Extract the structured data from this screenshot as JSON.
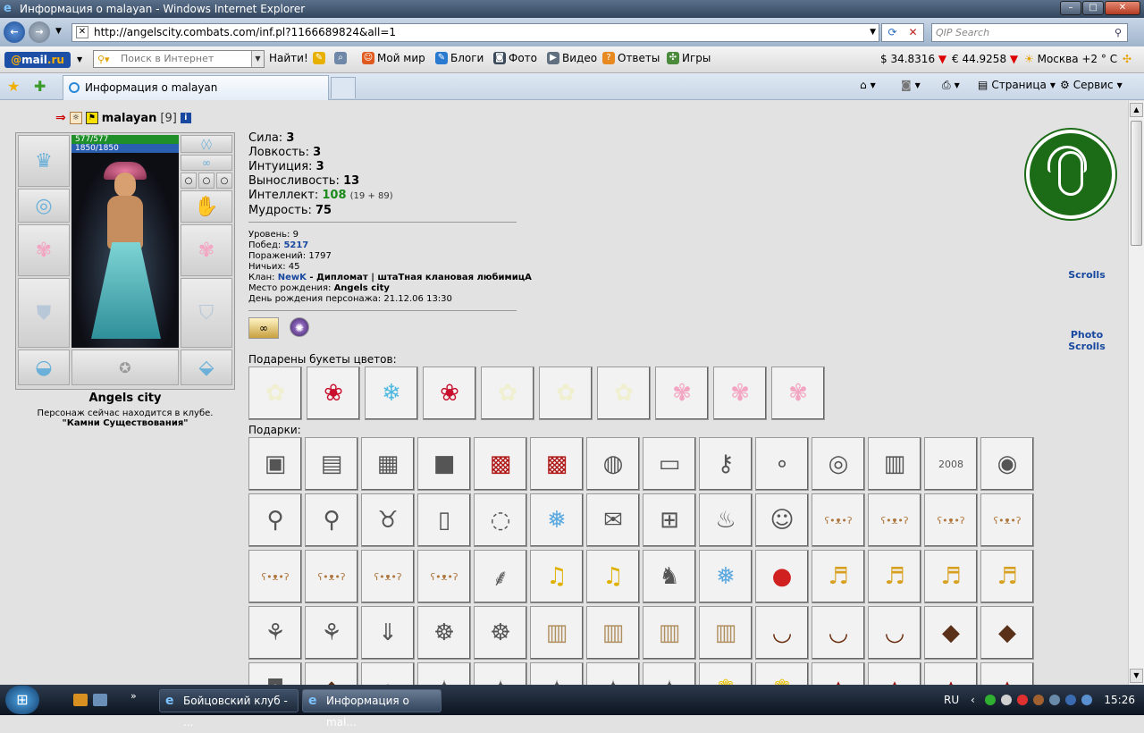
{
  "window": {
    "title": "Информация о malayan - Windows Internet Explorer"
  },
  "address": {
    "url": "http://angelscity.combats.com/inf.pl?1166689824&all=1",
    "search_placeholder": "QIP Search"
  },
  "mailbar": {
    "logo_prefix": "@",
    "logo_mail": "mail",
    "logo_suffix": ".ru",
    "search_placeholder": "Поиск в Интернет",
    "find_label": "Найти!",
    "links": [
      "Мой мир",
      "Блоги",
      "Фото",
      "Видео",
      "Ответы",
      "Игры"
    ],
    "usd": "$ 34.8316",
    "eur": "€ 44.9258",
    "weather": "Москва +2 ° C"
  },
  "tabs": {
    "active": "Информация о malayan",
    "page_menu": "Страница",
    "service_menu": "Сервис"
  },
  "character": {
    "name": "malayan",
    "level_tag": "[9]",
    "hp": "577/577",
    "mana": "1850/1850",
    "city": "Angels city",
    "location_text": "Персонаж сейчас находится в клубе.",
    "club_name": "\"Камни Существования\""
  },
  "stats": [
    {
      "label": "Сила:",
      "value": "3"
    },
    {
      "label": "Ловкость:",
      "value": "3"
    },
    {
      "label": "Интуиция:",
      "value": "3"
    },
    {
      "label": "Выносливость:",
      "value": "13"
    },
    {
      "label": "Интеллект:",
      "value": "108",
      "extra": "(19 + 89)"
    },
    {
      "label": "Мудрость:",
      "value": "75"
    }
  ],
  "info": {
    "level_label": "Уровень:",
    "level": "9",
    "wins_label": "Побед:",
    "wins": "5217",
    "losses_label": "Поражений:",
    "losses": "1797",
    "draws_label": "Ничьих:",
    "draws": "45",
    "clan_label": "Клан:",
    "clan": "NewK",
    "clan_role": " - Дипломат | штаТная клановая любимицА",
    "birthplace_label": "Место рождения:",
    "birthplace": "Angels city",
    "birthday_label": "День рождения персонажа:",
    "birthday": "21.12.06 13:30"
  },
  "sections": {
    "flowers": "Подарены букеты цветов:",
    "gifts": "Подарки:"
  },
  "flowers": [
    "daisy",
    "rose",
    "ice-flower",
    "rose",
    "daisy",
    "daisy",
    "daisy",
    "sakura",
    "sakura",
    "sakura"
  ],
  "gifts": [
    "silver-box",
    "chest",
    "silver-chest",
    "dark-chest",
    "gift-box",
    "gift-box",
    "handbag",
    "blue-box",
    "key",
    "pearls",
    "boa",
    "accordion",
    "2008",
    "gift-bag",
    "mirror",
    "mirror",
    "cow",
    "milk-can",
    "tambourine",
    "snowflake",
    "card",
    "window",
    "samovar",
    "doll",
    "teddy-bear",
    "teddy-bear",
    "teddy-bear",
    "teddy-bear",
    "teddy-bear",
    "teddy-bear",
    "teddy-bear",
    "teddy-bear",
    "broom",
    "bell",
    "bell",
    "rocking-horse",
    "snowflake",
    "red-nose",
    "bells",
    "bells",
    "bells",
    "bells",
    "ornaments",
    "ornaments",
    "icicle",
    "spider",
    "spider",
    "sack",
    "sack",
    "sack",
    "sack",
    "bucket",
    "bucket",
    "bucket",
    "chocolate",
    "chocolate",
    "bag",
    "chocolate",
    "necklace",
    "figure",
    "figure",
    "figure",
    "figure",
    "figure",
    "rose-gold",
    "rose-gold",
    "sign",
    "sign",
    "sign",
    "sign"
  ],
  "side_links": {
    "scrolls": "Scrolls",
    "photo": "Photo",
    "photo_scrolls": "Scrolls"
  },
  "taskbar": {
    "btn1": "Бойцовский клуб - ...",
    "btn2": "Информация о mal...",
    "lang": "RU",
    "clock": "15:26"
  },
  "icon_glyphs": {
    "daisy": "✿",
    "rose": "❀",
    "ice-flower": "❄",
    "sakura": "✾",
    "silver-box": "▣",
    "chest": "▤",
    "silver-chest": "▦",
    "dark-chest": "■",
    "gift-box": "▩",
    "handbag": "◍",
    "blue-box": "▭",
    "key": "⚷",
    "pearls": "∘",
    "boa": "◎",
    "accordion": "▥",
    "2008": "2008",
    "gift-bag": "◉",
    "mirror": "⚲",
    "cow": "♉",
    "milk-can": "▯",
    "tambourine": "◌",
    "snowflake": "❅",
    "card": "✉",
    "window": "⊞",
    "samovar": "♨",
    "doll": "☺",
    "teddy-bear": "ʕ•ᴥ•ʔ",
    "broom": "⸙",
    "bell": "♫",
    "rocking-horse": "♞",
    "red-nose": "●",
    "bells": "♬",
    "ornaments": "⚘",
    "icicle": "⇓",
    "spider": "☸",
    "sack": "▥",
    "bucket": "◡",
    "chocolate": "◆",
    "bag": "◘",
    "necklace": "◦",
    "figure": "✦",
    "rose-gold": "❁",
    "sign": "▲"
  },
  "colors": {
    "flower_daisy": "#f0f0d0",
    "flower_rose": "#c8102e",
    "flower_ice": "#4db8e0",
    "flower_sakura": "#f3a6c2"
  }
}
